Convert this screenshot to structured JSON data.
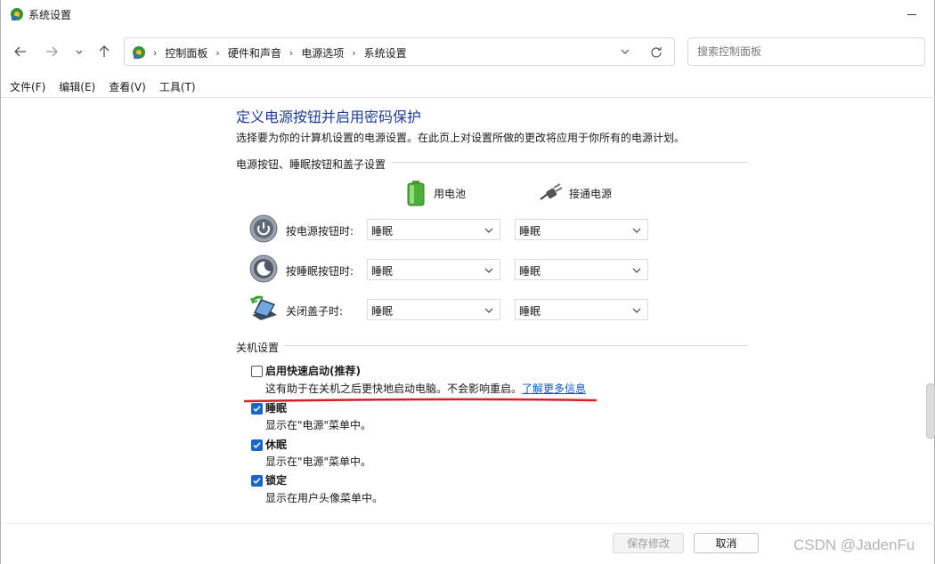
{
  "window": {
    "title": "系统设置"
  },
  "nav": {
    "breadcrumbs": [
      "控制面板",
      "硬件和声音",
      "电源选项",
      "系统设置"
    ],
    "search_placeholder": "搜索控制面板"
  },
  "menu": [
    "文件(F)",
    "编辑(E)",
    "查看(V)",
    "工具(T)"
  ],
  "page": {
    "title": "定义电源按钮并启用密码保护",
    "description": "选择要为你的计算机设置的电源设置。在此页上对设置所做的更改将应用于你所有的电源计划。"
  },
  "power_section": {
    "heading": "电源按钮、睡眠按钮和盖子设置",
    "columns": {
      "battery": "用电池",
      "plugged": "接通电源"
    },
    "rows": [
      {
        "label": "按电源按钮时:",
        "battery": "睡眠",
        "plugged": "睡眠",
        "icon": "power-button-icon"
      },
      {
        "label": "按睡眠按钮时:",
        "battery": "睡眠",
        "plugged": "睡眠",
        "icon": "sleep-button-icon"
      },
      {
        "label": "关闭盖子时:",
        "battery": "睡眠",
        "plugged": "睡眠",
        "icon": "laptop-lid-icon"
      }
    ]
  },
  "shutdown_section": {
    "heading": "关机设置",
    "options": [
      {
        "title": "启用快速启动(推荐)",
        "desc": "这有助于在关机之后更快地启动电脑。不会影响重启。",
        "link": "了解更多信息",
        "checked": false
      },
      {
        "title": "睡眠",
        "desc": "显示在\"电源\"菜单中。",
        "checked": true
      },
      {
        "title": "休眠",
        "desc": "显示在\"电源\"菜单中。",
        "checked": true
      },
      {
        "title": "锁定",
        "desc": "显示在用户头像菜单中。",
        "checked": true
      }
    ]
  },
  "footer": {
    "save": "保存修改",
    "cancel": "取消"
  },
  "watermark": "CSDN @JadenFu",
  "colors": {
    "title_blue": "#1e3c96",
    "link_blue": "#0b57c7",
    "check_blue": "#1a66c8",
    "annotation_red": "#d0202a"
  }
}
